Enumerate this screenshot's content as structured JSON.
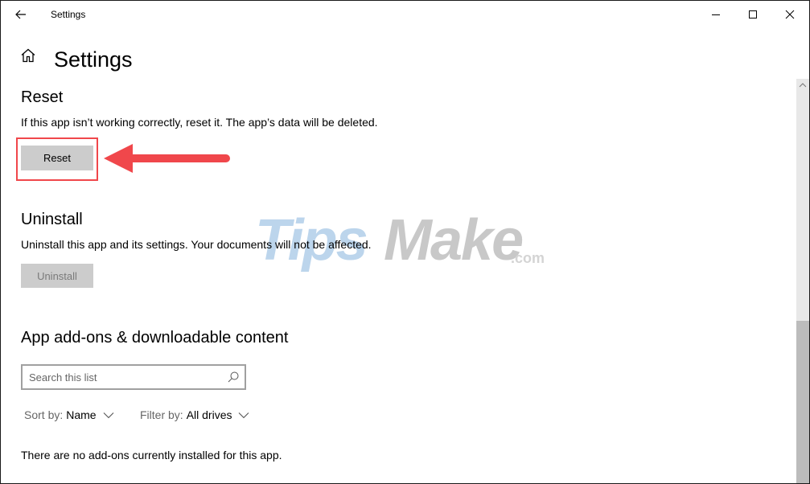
{
  "window": {
    "title": "Settings",
    "controls": {
      "minimize": "minimize",
      "maximize": "maximize",
      "close": "close"
    }
  },
  "header": {
    "title": "Settings"
  },
  "reset": {
    "title": "Reset",
    "description": "If this app isn’t working correctly, reset it. The app’s data will be deleted.",
    "button_label": "Reset"
  },
  "uninstall": {
    "title": "Uninstall",
    "description": "Uninstall this app and its settings. Your documents will not be affected.",
    "button_label": "Uninstall",
    "button_enabled": false
  },
  "addons": {
    "title": "App add-ons & downloadable content",
    "search": {
      "placeholder": "Search this list",
      "value": ""
    },
    "sort": {
      "label": "Sort by:",
      "value": "Name"
    },
    "filter": {
      "label": "Filter by:",
      "value": "All drives"
    },
    "empty_message": "There are no add-ons currently installed for this app."
  },
  "annotation": {
    "color": "#f0474b",
    "target": "reset-button"
  },
  "watermark": {
    "part1": "Tips",
    "part2": "Make",
    "part3": ".com"
  },
  "scrollbar": {
    "position_fraction": 0.6
  }
}
